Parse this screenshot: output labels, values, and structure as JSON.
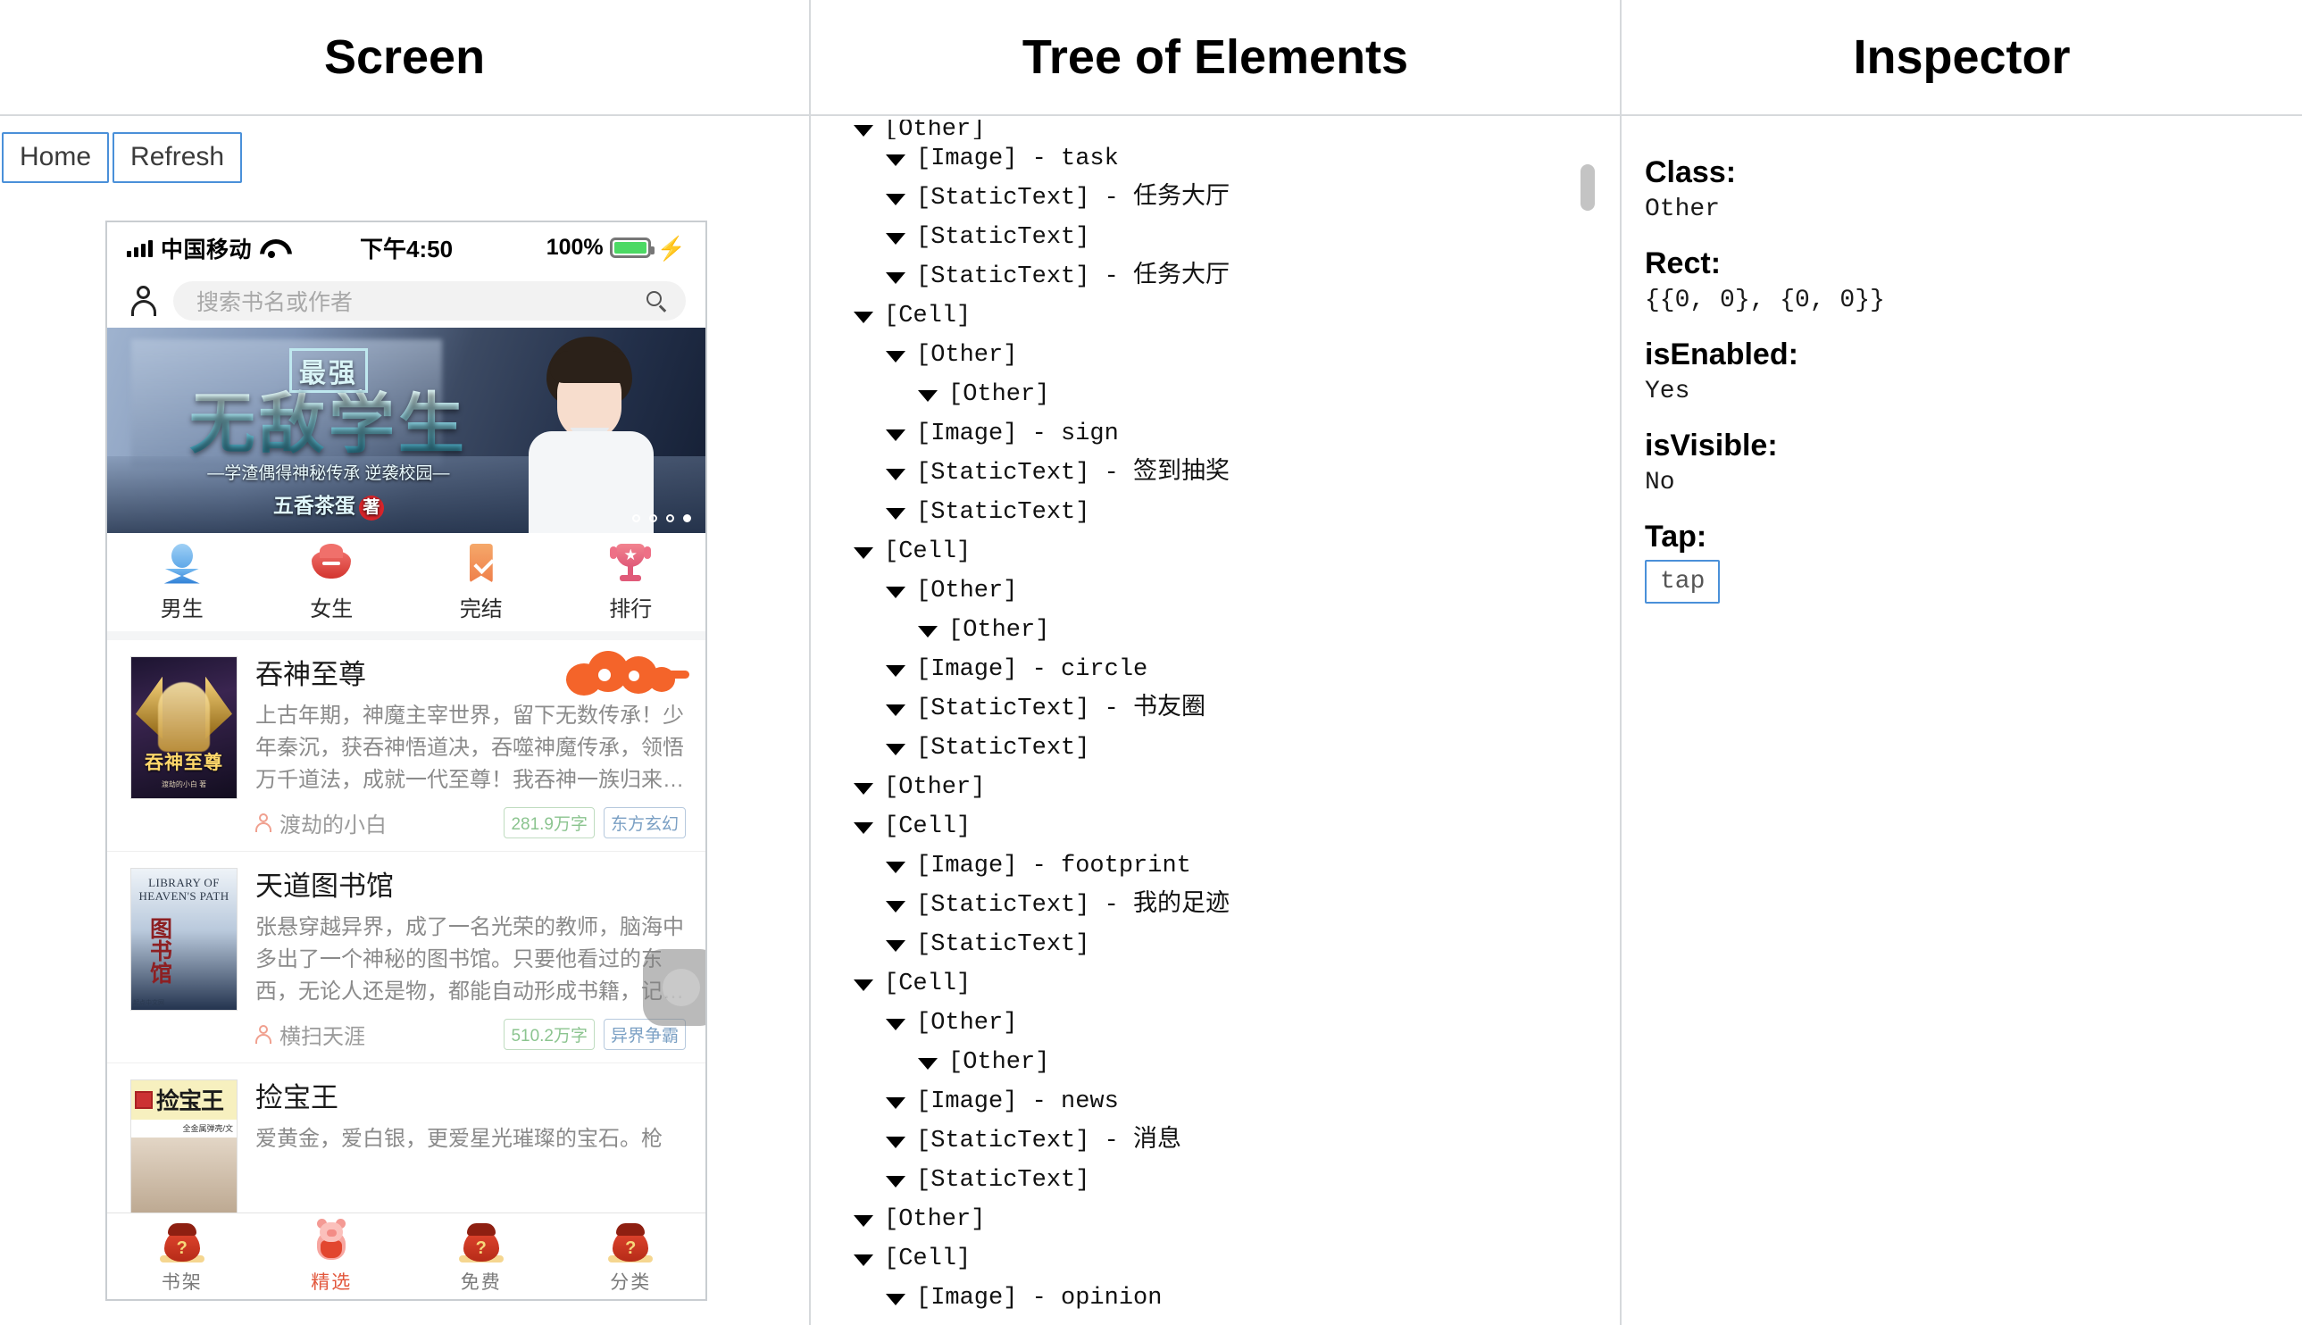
{
  "columns": {
    "screen_title": "Screen",
    "tree_title": "Tree of Elements",
    "inspector_title": "Inspector"
  },
  "toolbar": {
    "home_label": "Home",
    "refresh_label": "Refresh"
  },
  "phone": {
    "status_bar": {
      "carrier": "中国移动",
      "time": "下午4:50",
      "battery_percent": "100%"
    },
    "search": {
      "placeholder": "搜索书名或作者"
    },
    "banner": {
      "badge": "最强",
      "title": "无敌学生",
      "subtitle": "—学渣偶得神秘传承 逆袭校园—",
      "author": "五香茶蛋",
      "author_mark": "著",
      "dot_count": 4,
      "active_dot": 4
    },
    "categories": [
      {
        "label": "男生",
        "icon": "male-icon"
      },
      {
        "label": "女生",
        "icon": "lips-icon"
      },
      {
        "label": "完结",
        "icon": "bookmark-check-icon"
      },
      {
        "label": "排行",
        "icon": "trophy-icon"
      }
    ],
    "books": [
      {
        "title": "吞神至尊",
        "desc": "上古年期，神魔主宰世界，留下无数传承！少年秦沉，获吞神悟道决，吞噬神魔传承，领悟万千道法，成就一代至尊！我吞神一族归来…",
        "author": "渡劫的小白",
        "words": "281.9万字",
        "genre": "东方玄幻",
        "cover_title": "吞神至尊",
        "cover_author": "渡劫的小白 著"
      },
      {
        "title": "天道图书馆",
        "desc": "张悬穿越异界，成了一名光荣的教师，脑海中多出了一个神秘的图书馆。只要他看过的东西，无论人还是物，都能自动形成书籍，记…",
        "author": "横扫天涯",
        "words": "510.2万字",
        "genre": "异界争霸",
        "cover_en": "LIBRARY OF HEAVEN'S PATH",
        "cover_cn": "图书馆",
        "cover_tag": "起点中文网"
      },
      {
        "title": "捡宝王",
        "desc": "爱黄金，爱白银，更爱星光璀璨的宝石。枪",
        "cover_title": "捡宝王",
        "cover_sub": "全金属弹壳/文"
      }
    ],
    "tabs": [
      {
        "label": "书架",
        "active": false,
        "icon": "money-bag-icon"
      },
      {
        "label": "精选",
        "active": true,
        "icon": "pig-icon"
      },
      {
        "label": "免费",
        "active": false,
        "icon": "money-bag-icon"
      },
      {
        "label": "分类",
        "active": false,
        "icon": "money-bag-icon"
      }
    ]
  },
  "tree": {
    "nodes": [
      {
        "indent": 1,
        "text": "[Other]",
        "clipped": true
      },
      {
        "indent": 2,
        "text": "[Image] - task"
      },
      {
        "indent": 2,
        "text": "[StaticText] - 任务大厅"
      },
      {
        "indent": 2,
        "text": "[StaticText]"
      },
      {
        "indent": 2,
        "text": "[StaticText] - 任务大厅"
      },
      {
        "indent": 1,
        "text": "[Cell]"
      },
      {
        "indent": 2,
        "text": "[Other]"
      },
      {
        "indent": 3,
        "text": "[Other]"
      },
      {
        "indent": 2,
        "text": "[Image] - sign"
      },
      {
        "indent": 2,
        "text": "[StaticText] - 签到抽奖"
      },
      {
        "indent": 2,
        "text": "[StaticText]"
      },
      {
        "indent": 1,
        "text": "[Cell]"
      },
      {
        "indent": 2,
        "text": "[Other]"
      },
      {
        "indent": 3,
        "text": "[Other]"
      },
      {
        "indent": 2,
        "text": "[Image] - circle"
      },
      {
        "indent": 2,
        "text": "[StaticText] - 书友圈"
      },
      {
        "indent": 2,
        "text": "[StaticText]"
      },
      {
        "indent": 1,
        "text": "[Other]"
      },
      {
        "indent": 1,
        "text": "[Cell]"
      },
      {
        "indent": 2,
        "text": "[Image] - footprint"
      },
      {
        "indent": 2,
        "text": "[StaticText] - 我的足迹"
      },
      {
        "indent": 2,
        "text": "[StaticText]"
      },
      {
        "indent": 1,
        "text": "[Cell]"
      },
      {
        "indent": 2,
        "text": "[Other]"
      },
      {
        "indent": 3,
        "text": "[Other]"
      },
      {
        "indent": 2,
        "text": "[Image] - news"
      },
      {
        "indent": 2,
        "text": "[StaticText] - 消息"
      },
      {
        "indent": 2,
        "text": "[StaticText]"
      },
      {
        "indent": 1,
        "text": "[Other]"
      },
      {
        "indent": 1,
        "text": "[Cell]"
      },
      {
        "indent": 2,
        "text": "[Image] - opinion"
      }
    ]
  },
  "inspector": {
    "fields": [
      {
        "key": "Class:",
        "value": "Other"
      },
      {
        "key": "Rect:",
        "value": "{{0, 0}, {0, 0}}"
      },
      {
        "key": "isEnabled:",
        "value": "Yes"
      },
      {
        "key": "isVisible:",
        "value": "No"
      },
      {
        "key": "Tap:",
        "value": ""
      }
    ],
    "tap_button_label": "tap"
  },
  "colors": {
    "accent_blue": "#4a90d9",
    "tab_active": "#e2573c",
    "battery_green": "#4cd964",
    "tag_words": "#8bc48f",
    "tag_genre": "#7ba0c4"
  }
}
